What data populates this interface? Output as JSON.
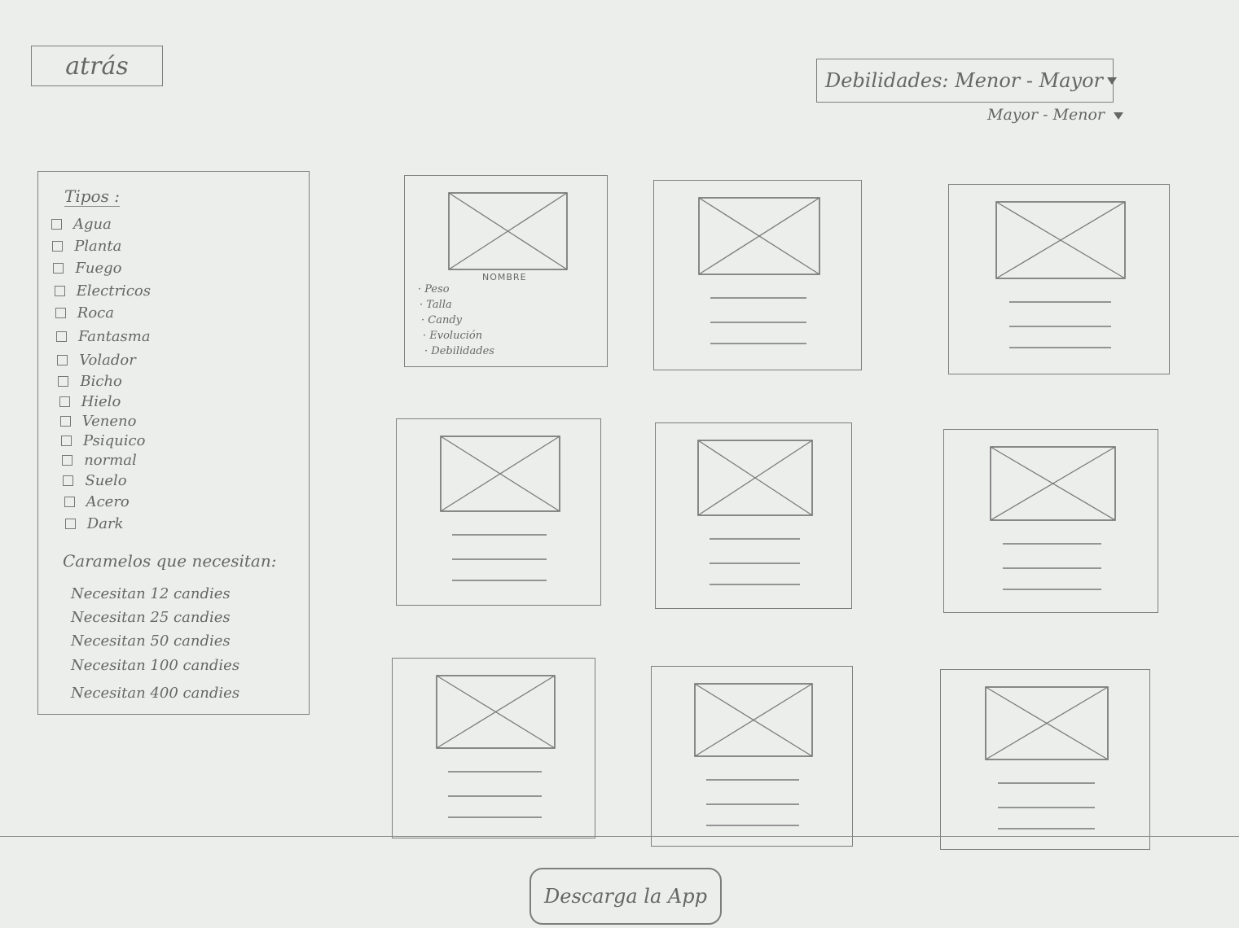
{
  "header": {
    "back_label": "atrás",
    "sort_label": "Debilidades:",
    "sort_option_selected": "Menor - Mayor",
    "sort_option_alt": "Mayor - Menor"
  },
  "filters": {
    "types_title": "Tipos :",
    "types": [
      "Agua",
      "Planta",
      "Fuego",
      "Electricos",
      "Roca",
      "Fantasma",
      "Volador",
      "Bicho",
      "Hielo",
      "Veneno",
      "Psiquico",
      "normal",
      "Suelo",
      "Acero",
      "Dark"
    ],
    "candies_title": "Caramelos que necesitan:",
    "candies": [
      "Necesitan 12 candies",
      "Necesitan 25 candies",
      "Necesitan 50 candies",
      "Necesitan 100 candies",
      "Necesitan 400 candies"
    ]
  },
  "cards": {
    "first": {
      "name": "NOMBRE",
      "attributes": [
        "· Peso",
        "· Talla",
        "· Candy",
        "· Evolución",
        "· Debilidades"
      ]
    }
  },
  "footer": {
    "download_label": "Descarga la App"
  }
}
